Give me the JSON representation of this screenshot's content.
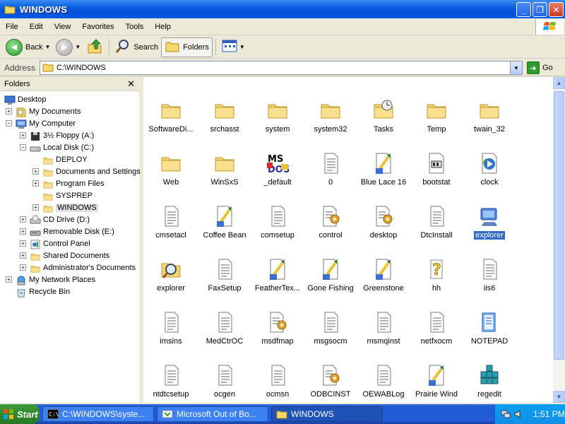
{
  "window": {
    "title": "WINDOWS"
  },
  "menu": [
    "File",
    "Edit",
    "View",
    "Favorites",
    "Tools",
    "Help"
  ],
  "toolbar": {
    "back": "Back",
    "search": "Search",
    "folders": "Folders"
  },
  "address": {
    "label": "Address",
    "path": "C:\\WINDOWS",
    "go": "Go"
  },
  "folder_pane": {
    "title": "Folders",
    "tree": [
      {
        "label": "Desktop",
        "icon": "desktop-icon",
        "level": 0,
        "expander": ""
      },
      {
        "label": "My Documents",
        "icon": "my-documents-icon",
        "level": 1,
        "expander": "+"
      },
      {
        "label": "My Computer",
        "icon": "my-computer-icon",
        "level": 1,
        "expander": "−"
      },
      {
        "label": "3½ Floppy (A:)",
        "icon": "floppy-icon",
        "level": 2,
        "expander": "+"
      },
      {
        "label": "Local Disk (C:)",
        "icon": "local-disk-icon",
        "level": 2,
        "expander": "−"
      },
      {
        "label": "DEPLOY",
        "icon": "folder-icon",
        "level": 3,
        "expander": ""
      },
      {
        "label": "Documents and Settings",
        "icon": "folder-icon",
        "level": 3,
        "expander": "+"
      },
      {
        "label": "Program Files",
        "icon": "folder-icon",
        "level": 3,
        "expander": "+"
      },
      {
        "label": "SYSPREP",
        "icon": "folder-icon",
        "level": 3,
        "expander": ""
      },
      {
        "label": "WINDOWS",
        "icon": "open-folder-icon",
        "level": 3,
        "expander": "+",
        "selected": true
      },
      {
        "label": "CD Drive (D:)",
        "icon": "cd-drive-icon",
        "level": 2,
        "expander": "+"
      },
      {
        "label": "Removable Disk (E:)",
        "icon": "removable-disk-icon",
        "level": 2,
        "expander": "+"
      },
      {
        "label": "Control Panel",
        "icon": "control-panel-icon",
        "level": 2,
        "expander": "+"
      },
      {
        "label": "Shared Documents",
        "icon": "folder-icon",
        "level": 2,
        "expander": "+"
      },
      {
        "label": "Administrator's Documents",
        "icon": "folder-icon",
        "level": 2,
        "expander": "+"
      },
      {
        "label": "My Network Places",
        "icon": "network-places-icon",
        "level": 1,
        "expander": "+"
      },
      {
        "label": "Recycle Bin",
        "icon": "recycle-bin-icon",
        "level": 1,
        "expander": ""
      }
    ]
  },
  "files": [
    [
      {
        "name": "SoftwareDi...",
        "icon": "folder-icon"
      },
      {
        "name": "srchasst",
        "icon": "folder-icon"
      },
      {
        "name": "system",
        "icon": "folder-icon"
      },
      {
        "name": "system32",
        "icon": "folder-icon"
      },
      {
        "name": "Tasks",
        "icon": "tasks-folder-icon"
      },
      {
        "name": "Temp",
        "icon": "folder-icon"
      },
      {
        "name": "twain_32",
        "icon": "folder-icon"
      }
    ],
    [
      {
        "name": "Web",
        "icon": "folder-icon"
      },
      {
        "name": "WinSxS",
        "icon": "folder-icon"
      },
      {
        "name": "_default",
        "icon": "ms-dos-icon"
      },
      {
        "name": "0",
        "icon": "text-file-icon"
      },
      {
        "name": "Blue Lace 16",
        "icon": "paint-bitmap-icon"
      },
      {
        "name": "bootstat",
        "icon": "dat-file-icon"
      },
      {
        "name": "clock",
        "icon": "media-file-icon"
      }
    ],
    [
      {
        "name": "cmsetacl",
        "icon": "text-file-icon"
      },
      {
        "name": "Coffee Bean",
        "icon": "paint-bitmap-icon"
      },
      {
        "name": "comsetup",
        "icon": "text-file-icon"
      },
      {
        "name": "control",
        "icon": "config-file-icon"
      },
      {
        "name": "desktop",
        "icon": "config-file-icon"
      },
      {
        "name": "DtcInstall",
        "icon": "text-file-icon"
      },
      {
        "name": "explorer",
        "icon": "computer-app-icon",
        "selected": true
      }
    ],
    [
      {
        "name": "explorer",
        "icon": "search-document-icon"
      },
      {
        "name": "FaxSetup",
        "icon": "text-file-icon"
      },
      {
        "name": "FeatherTex...",
        "icon": "paint-bitmap-icon"
      },
      {
        "name": "Gone Fishing",
        "icon": "paint-bitmap-icon"
      },
      {
        "name": "Greenstone",
        "icon": "paint-bitmap-icon"
      },
      {
        "name": "hh",
        "icon": "help-icon"
      },
      {
        "name": "iis6",
        "icon": "text-file-icon"
      }
    ],
    [
      {
        "name": "imsins",
        "icon": "text-file-icon"
      },
      {
        "name": "MedCtrOC",
        "icon": "text-file-icon"
      },
      {
        "name": "msdfmap",
        "icon": "config-file-icon"
      },
      {
        "name": "msgsocm",
        "icon": "text-file-icon"
      },
      {
        "name": "msmqinst",
        "icon": "text-file-icon"
      },
      {
        "name": "netfxocm",
        "icon": "text-file-icon"
      },
      {
        "name": "NOTEPAD",
        "icon": "notepad-icon"
      }
    ],
    [
      {
        "name": "ntdtcsetup",
        "icon": "text-file-icon"
      },
      {
        "name": "ocgen",
        "icon": "text-file-icon"
      },
      {
        "name": "ocmsn",
        "icon": "text-file-icon"
      },
      {
        "name": "ODBCINST",
        "icon": "config-file-icon"
      },
      {
        "name": "OEWABLog",
        "icon": "text-file-icon"
      },
      {
        "name": "Prairie Wind",
        "icon": "paint-bitmap-icon"
      },
      {
        "name": "regedit",
        "icon": "regedit-icon"
      }
    ]
  ],
  "taskbar": {
    "start": "Start",
    "tasks": [
      {
        "label": "C:\\WINDOWS\\syste...",
        "icon": "cmd-icon"
      },
      {
        "label": "Microsoft Out of Bo...",
        "icon": "oobe-icon"
      },
      {
        "label": "WINDOWS",
        "icon": "open-folder-icon",
        "active": true
      }
    ],
    "clock": "1:51 PM"
  }
}
